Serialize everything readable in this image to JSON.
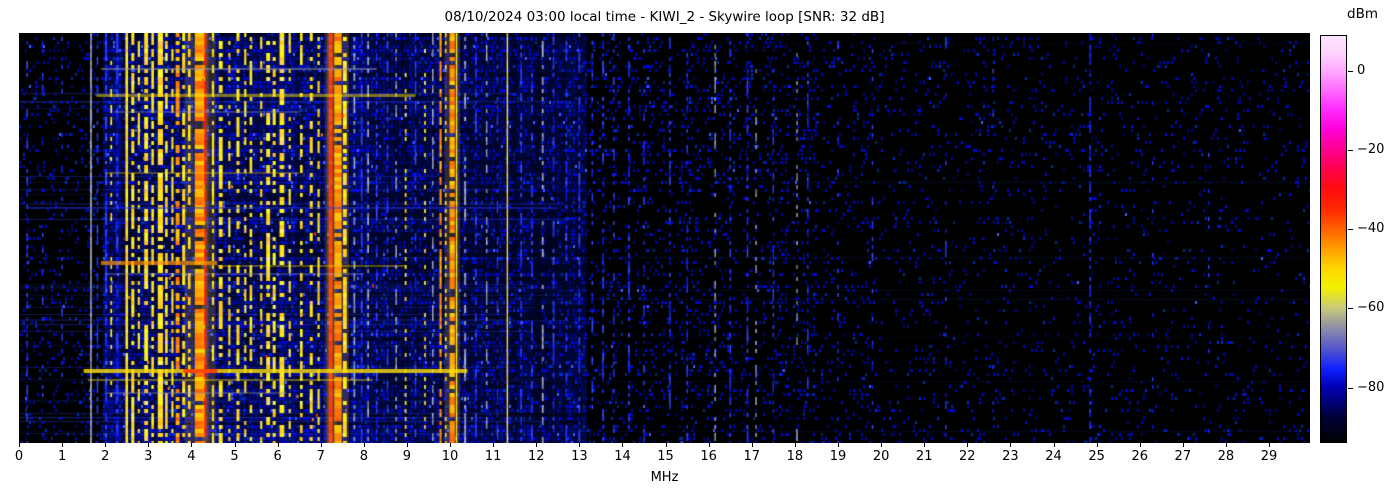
{
  "chart_data": {
    "type": "heatmap",
    "subtype": "radio-spectrogram-waterfall",
    "title": "08/10/2024 03:00 local time - KIWI_2 - Skywire loop [SNR: 32 dB]",
    "xlabel": "MHz",
    "x_ticks": [
      0,
      1,
      2,
      3,
      4,
      5,
      6,
      7,
      8,
      9,
      10,
      11,
      12,
      13,
      14,
      15,
      16,
      17,
      18,
      19,
      20,
      21,
      22,
      23,
      24,
      25,
      26,
      27,
      28,
      29
    ],
    "x_range": [
      0,
      29.95
    ],
    "y_axis_labels": [],
    "colorbar": {
      "label": "dBm",
      "ticks": [
        0,
        -20,
        -40,
        -60,
        -80
      ],
      "value_range": [
        -94,
        9
      ],
      "gradient_stops": [
        [
          0,
          "#000000"
        ],
        [
          6,
          "#000038"
        ],
        [
          13.5,
          "#0000b4"
        ],
        [
          18,
          "#1020ff"
        ],
        [
          23,
          "#5555cc"
        ],
        [
          28,
          "#8d8da8"
        ],
        [
          33,
          "#c9c97a"
        ],
        [
          38,
          "#f2f200"
        ],
        [
          43,
          "#ffd200"
        ],
        [
          48,
          "#ff9a00"
        ],
        [
          52.5,
          "#ff6000"
        ],
        [
          57.5,
          "#ff2800"
        ],
        [
          62.5,
          "#ff0a10"
        ],
        [
          67.5,
          "#ff0050"
        ],
        [
          72,
          "#ff0090"
        ],
        [
          77,
          "#ff00d8"
        ],
        [
          82,
          "#ff2cff"
        ],
        [
          87,
          "#ff70ff"
        ],
        [
          91.5,
          "#ffaaff"
        ],
        [
          96,
          "#ffd6ff"
        ],
        [
          100,
          "#fbe4fb"
        ]
      ]
    },
    "palette": {
      "yellow": [
        255,
        225,
        0
      ],
      "orange": [
        255,
        150,
        0
      ],
      "red": [
        255,
        40,
        0
      ],
      "gray": [
        150,
        156,
        178
      ],
      "blue": [
        30,
        50,
        255
      ]
    },
    "background_noise": [
      {
        "f0": 0,
        "f1": 1.55,
        "level": 0.22
      },
      {
        "f0": 1.55,
        "f1": 1.95,
        "level": 0.4
      },
      {
        "f0": 1.95,
        "f1": 8.3,
        "level": 0.85
      },
      {
        "f0": 8.3,
        "f1": 10.4,
        "level": 0.62
      },
      {
        "f0": 10.4,
        "f1": 13.2,
        "level": 0.52
      },
      {
        "f0": 13.2,
        "f1": 18.5,
        "level": 0.3
      },
      {
        "f0": 18.5,
        "f1": 24,
        "level": 0.16
      },
      {
        "f0": 24,
        "f1": 29.95,
        "level": 0.13
      }
    ],
    "vertical_bands": [
      {
        "f": 0.19,
        "w": 0.035,
        "c": "blue",
        "d": 0.35
      },
      {
        "f": 0.55,
        "w": 0.03,
        "c": "blue",
        "d": 0.25
      },
      {
        "f": 1.0,
        "w": 0.03,
        "c": "blue",
        "d": 0.25
      },
      {
        "f": 1.67,
        "w": 0.04,
        "c": "gray",
        "d": 1.0
      },
      {
        "f": 1.82,
        "w": 0.035,
        "c": "blue",
        "d": 0.5
      },
      {
        "f": 2.02,
        "w": 0.05,
        "c": "blue",
        "d": 0.7
      },
      {
        "f": 2.14,
        "w": 0.04,
        "c": "yellow",
        "d": 0.4
      },
      {
        "f": 2.28,
        "w": 0.05,
        "c": "blue",
        "d": 0.65
      },
      {
        "f": 2.5,
        "w": 0.06,
        "c": "yellow",
        "d": 0.95
      },
      {
        "f": 2.64,
        "w": 0.07,
        "c": "yellow",
        "d": 0.6
      },
      {
        "f": 2.78,
        "w": 0.05,
        "c": "yellow",
        "d": 0.5
      },
      {
        "f": 2.95,
        "w": 0.09,
        "c": "yellow",
        "d": 0.65
      },
      {
        "f": 3.1,
        "w": 0.06,
        "c": "yellow",
        "d": 0.55
      },
      {
        "f": 3.28,
        "w": 0.12,
        "c": "yellow",
        "d": 0.8
      },
      {
        "f": 3.42,
        "w": 0.06,
        "c": "yellow",
        "d": 0.65
      },
      {
        "f": 3.56,
        "w": 0.05,
        "c": "yellow",
        "d": 0.5
      },
      {
        "f": 3.68,
        "w": 0.09,
        "c": "orange",
        "d": 0.6
      },
      {
        "f": 3.82,
        "w": 0.07,
        "c": "yellow",
        "d": 0.6
      },
      {
        "f": 3.95,
        "w": 0.06,
        "c": "yellow",
        "d": 0.55
      },
      {
        "f": 4.2,
        "w": 0.24,
        "c": "orange",
        "d": 0.92
      },
      {
        "f": 4.32,
        "w": 0.05,
        "c": "red",
        "d": 0.85
      },
      {
        "f": 4.5,
        "w": 0.05,
        "c": "yellow",
        "d": 0.6
      },
      {
        "f": 4.68,
        "w": 0.09,
        "c": "yellow",
        "d": 0.55
      },
      {
        "f": 4.88,
        "w": 0.05,
        "c": "yellow",
        "d": 0.45
      },
      {
        "f": 5.08,
        "w": 0.07,
        "c": "yellow",
        "d": 0.5
      },
      {
        "f": 5.25,
        "w": 0.05,
        "c": "yellow",
        "d": 0.4
      },
      {
        "f": 5.38,
        "w": 0.06,
        "c": "yellow",
        "d": 0.45
      },
      {
        "f": 5.62,
        "w": 0.05,
        "c": "yellow",
        "d": 0.4
      },
      {
        "f": 5.78,
        "w": 0.09,
        "c": "yellow",
        "d": 0.55
      },
      {
        "f": 5.92,
        "w": 0.07,
        "c": "yellow",
        "d": 0.5
      },
      {
        "f": 6.1,
        "w": 0.11,
        "c": "yellow",
        "d": 0.6
      },
      {
        "f": 6.28,
        "w": 0.05,
        "c": "yellow",
        "d": 0.4
      },
      {
        "f": 6.55,
        "w": 0.06,
        "c": "yellow",
        "d": 0.45
      },
      {
        "f": 6.78,
        "w": 0.07,
        "c": "yellow",
        "d": 0.5
      },
      {
        "f": 6.95,
        "w": 0.05,
        "c": "yellow",
        "d": 0.45
      },
      {
        "f": 7.23,
        "w": 0.09,
        "c": "red",
        "d": 1.0
      },
      {
        "f": 7.4,
        "w": 0.17,
        "c": "orange",
        "d": 0.85
      },
      {
        "f": 7.56,
        "w": 0.09,
        "c": "yellow",
        "d": 0.7
      },
      {
        "f": 7.78,
        "w": 0.04,
        "c": "gray",
        "d": 0.5
      },
      {
        "f": 7.95,
        "w": 0.04,
        "c": "blue",
        "d": 0.55
      },
      {
        "f": 8.1,
        "w": 0.04,
        "c": "gray",
        "d": 0.45
      },
      {
        "f": 8.3,
        "w": 0.04,
        "c": "blue",
        "d": 0.5
      },
      {
        "f": 8.55,
        "w": 0.035,
        "c": "blue",
        "d": 0.45
      },
      {
        "f": 8.75,
        "w": 0.035,
        "c": "gray",
        "d": 0.4
      },
      {
        "f": 8.97,
        "w": 0.04,
        "c": "yellow",
        "d": 0.6,
        "s": "dotted"
      },
      {
        "f": 9.2,
        "w": 0.035,
        "c": "blue",
        "d": 0.5
      },
      {
        "f": 9.42,
        "w": 0.04,
        "c": "yellow",
        "d": 0.5,
        "s": "dotted"
      },
      {
        "f": 9.6,
        "w": 0.035,
        "c": "gray",
        "d": 0.55
      },
      {
        "f": 9.78,
        "w": 0.05,
        "c": "orange",
        "d": 0.7
      },
      {
        "f": 9.9,
        "w": 0.04,
        "c": "yellow",
        "d": 0.5,
        "s": "dotted"
      },
      {
        "f": 10.05,
        "w": 0.12,
        "c": "orange",
        "d": 0.85
      },
      {
        "f": 10.15,
        "w": 0.03,
        "c": "yellow",
        "d": 1.0
      },
      {
        "f": 10.35,
        "w": 0.045,
        "c": "gray",
        "d": 0.5
      },
      {
        "f": 10.6,
        "w": 0.04,
        "c": "blue",
        "d": 0.5
      },
      {
        "f": 10.85,
        "w": 0.035,
        "c": "gray",
        "d": 0.4
      },
      {
        "f": 11.1,
        "w": 0.03,
        "c": "blue",
        "d": 0.4
      },
      {
        "f": 11.33,
        "w": 0.03,
        "c": "yellow",
        "d": 1.0
      },
      {
        "f": 11.65,
        "w": 0.04,
        "c": "blue",
        "d": 0.6
      },
      {
        "f": 11.9,
        "w": 0.04,
        "c": "blue",
        "d": 0.5
      },
      {
        "f": 12.15,
        "w": 0.04,
        "c": "gray",
        "d": 0.45
      },
      {
        "f": 12.4,
        "w": 0.04,
        "c": "blue",
        "d": 0.5
      },
      {
        "f": 12.7,
        "w": 0.04,
        "c": "blue",
        "d": 0.45
      },
      {
        "f": 13.0,
        "w": 0.04,
        "c": "blue",
        "d": 0.5
      },
      {
        "f": 13.3,
        "w": 0.035,
        "c": "blue",
        "d": 0.4
      },
      {
        "f": 13.55,
        "w": 0.04,
        "c": "blue",
        "d": 0.45
      },
      {
        "f": 13.8,
        "w": 0.035,
        "c": "blue",
        "d": 0.4
      },
      {
        "f": 14.15,
        "w": 0.04,
        "c": "blue",
        "d": 0.5
      },
      {
        "f": 14.5,
        "w": 0.03,
        "c": "blue",
        "d": 0.35
      },
      {
        "f": 15.1,
        "w": 0.035,
        "c": "blue",
        "d": 0.45
      },
      {
        "f": 15.5,
        "w": 0.03,
        "c": "blue",
        "d": 0.4
      },
      {
        "f": 16.15,
        "w": 0.03,
        "c": "gray",
        "d": 0.4
      },
      {
        "f": 16.5,
        "w": 0.03,
        "c": "blue",
        "d": 0.35
      },
      {
        "f": 16.9,
        "w": 0.035,
        "c": "blue",
        "d": 0.5
      },
      {
        "f": 17.1,
        "w": 0.03,
        "c": "gray",
        "d": 0.35
      },
      {
        "f": 17.5,
        "w": 0.03,
        "c": "blue",
        "d": 0.4
      },
      {
        "f": 18.05,
        "w": 0.03,
        "c": "gray",
        "d": 0.35
      },
      {
        "f": 18.3,
        "w": 0.03,
        "c": "blue",
        "d": 0.35
      },
      {
        "f": 19.0,
        "w": 0.03,
        "c": "blue",
        "d": 0.18
      },
      {
        "f": 19.8,
        "w": 0.03,
        "c": "blue",
        "d": 0.18
      },
      {
        "f": 21.5,
        "w": 0.03,
        "c": "blue",
        "d": 0.22
      },
      {
        "f": 22.6,
        "w": 0.03,
        "c": "blue",
        "d": 0.14
      },
      {
        "f": 24.85,
        "w": 0.03,
        "c": "blue",
        "d": 0.55
      },
      {
        "f": 26.3,
        "w": 0.03,
        "c": "blue",
        "d": 0.12
      },
      {
        "f": 27.6,
        "w": 0.03,
        "c": "blue",
        "d": 0.12
      }
    ],
    "horizontal_streaks": [
      {
        "y": 0.085,
        "f0": 1.9,
        "f1": 8.3,
        "c": "gray",
        "a": 0.5,
        "h": 2
      },
      {
        "y": 0.148,
        "f0": 1.8,
        "f1": 9.2,
        "c": "yellow",
        "a": 0.5,
        "h": 3
      },
      {
        "y": 0.19,
        "f0": 2.2,
        "f1": 6.5,
        "c": "gray",
        "a": 0.35,
        "h": 2
      },
      {
        "y": 0.34,
        "f0": 2.0,
        "f1": 6.5,
        "c": "yellow",
        "a": 0.3,
        "h": 2
      },
      {
        "y": 0.425,
        "f0": 0.2,
        "f1": 12.5,
        "c": "blue",
        "a": 0.45,
        "h": 2
      },
      {
        "y": 0.555,
        "f0": 1.9,
        "f1": 4.6,
        "c": "orange",
        "a": 0.7,
        "h": 4
      },
      {
        "y": 0.565,
        "f0": 4.6,
        "f1": 9.0,
        "c": "yellow",
        "a": 0.35,
        "h": 2
      },
      {
        "y": 0.585,
        "f0": 2.0,
        "f1": 8.0,
        "c": "gray",
        "a": 0.3,
        "h": 2
      },
      {
        "y": 0.82,
        "f0": 1.5,
        "f1": 10.4,
        "c": "yellow",
        "a": 0.8,
        "h": 4
      },
      {
        "y": 0.82,
        "f0": 3.8,
        "f1": 4.6,
        "c": "red",
        "a": 0.8,
        "h": 4
      },
      {
        "y": 0.845,
        "f0": 1.6,
        "f1": 8.2,
        "c": "yellow",
        "a": 0.4,
        "h": 2
      },
      {
        "y": 0.875,
        "f0": 2.0,
        "f1": 6.2,
        "c": "gray",
        "a": 0.35,
        "h": 2
      }
    ],
    "render": {
      "seed": 1337,
      "thin_blue_rows": 30,
      "faint_full_rows": 10,
      "hot_specks": 26
    }
  }
}
